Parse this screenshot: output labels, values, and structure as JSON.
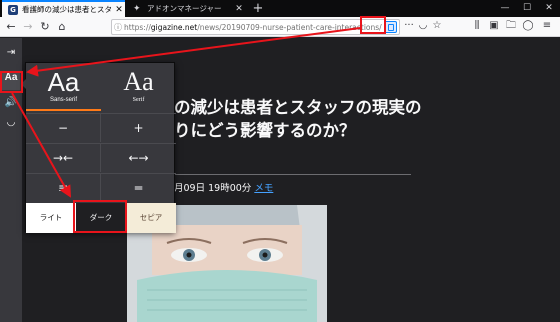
{
  "browser": {
    "tabs": [
      {
        "title": "看護師の減少は患者とスタッフの現",
        "icon": "gigazine-favicon",
        "active": true
      },
      {
        "title": "アドオンマネージャー",
        "icon": "puzzle-icon",
        "active": false
      }
    ],
    "new_tab_symbol": "+",
    "window_controls": {
      "minimize": "—",
      "maximize": "☐",
      "close": "✕"
    },
    "url": {
      "prefix": "https://",
      "domain": "gigazine.net",
      "path": "/news/20190709-nurse-patient-care-interactions/"
    },
    "toolbar_symbols": {
      "more": "···",
      "pocket": "◡",
      "bookmark": "☆",
      "library": "⫼",
      "sidebar": "▣",
      "folder": "🗀",
      "account": "◯",
      "menu": "≡"
    }
  },
  "reader": {
    "toolbar": {
      "close_symbol": "⇥",
      "aa_label": "Aa",
      "listen_symbol": "🔊",
      "pocket_symbol": "◡"
    },
    "popup": {
      "fonts": [
        {
          "big": "Aa",
          "label": "Sans-serif"
        },
        {
          "big": "Aa",
          "label": "Serif"
        }
      ],
      "minus": "−",
      "plus": "+",
      "narrower": "→←",
      "wider": "←→",
      "line_height_less": "≡",
      "line_height_more": "═",
      "themes": {
        "light": "ライト",
        "dark": "ダーク",
        "sepia": "セピア"
      }
    }
  },
  "article": {
    "title_line1": "の減少は患者とスタッフの現実の",
    "title_line2": "りにどう影響するのか？",
    "meta": "月09日 19時00分 ",
    "memo": "メモ"
  },
  "annotation_color": "#e8141b"
}
